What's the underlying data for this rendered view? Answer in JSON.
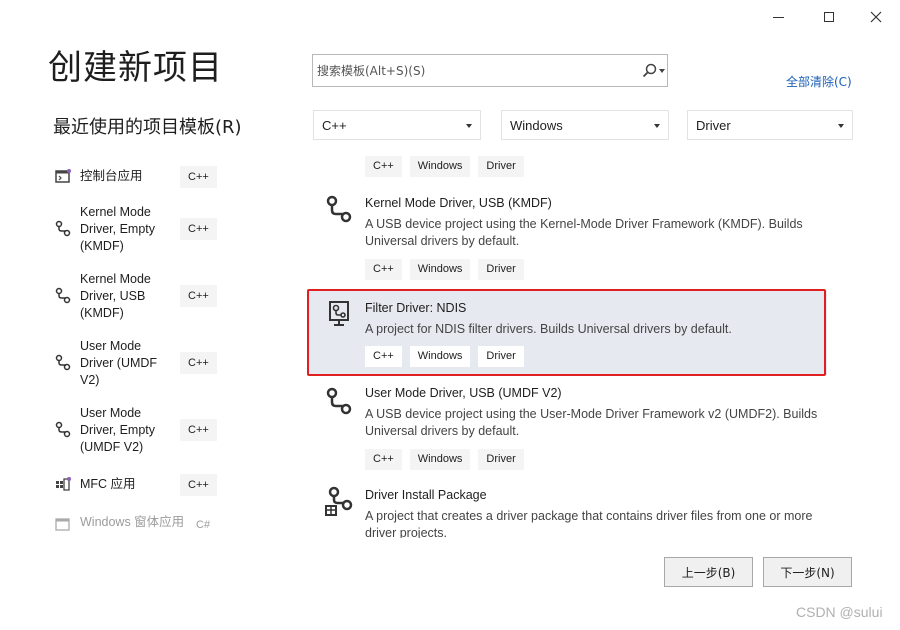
{
  "page_title": "创建新项目",
  "search": {
    "placeholder": "搜索模板(Alt+S)(S)"
  },
  "clear_all": "全部清除(C)",
  "recent_title": "最近使用的项目模板(R)",
  "filters": {
    "language": "C++",
    "platform": "Windows",
    "project_type": "Driver"
  },
  "recent": [
    {
      "name": "控制台应用",
      "tag": "C++",
      "icon": "console-app-icon"
    },
    {
      "name": "Kernel Mode Driver, Empty (KMDF)",
      "tag": "C++",
      "icon": "driver-icon"
    },
    {
      "name": "Kernel Mode Driver, USB (KMDF)",
      "tag": "C++",
      "icon": "driver-icon"
    },
    {
      "name": "User Mode Driver (UMDF V2)",
      "tag": "C++",
      "icon": "driver-icon"
    },
    {
      "name": "User Mode Driver, Empty (UMDF V2)",
      "tag": "C++",
      "icon": "driver-icon"
    },
    {
      "name": "MFC 应用",
      "tag": "C++",
      "icon": "mfc-app-icon"
    },
    {
      "name": "Windows 窗体应用",
      "tag": "C#",
      "icon": "windows-forms-icon"
    }
  ],
  "templates": [
    {
      "title": "",
      "desc": "",
      "tags": [
        "C++",
        "Windows",
        "Driver"
      ]
    },
    {
      "title": "Kernel Mode Driver, USB (KMDF)",
      "desc": "A USB device project using the Kernel-Mode Driver Framework (KMDF). Builds Universal drivers by default.",
      "tags": [
        "C++",
        "Windows",
        "Driver"
      ]
    },
    {
      "title": "Filter Driver: NDIS",
      "desc": "A project for NDIS filter drivers. Builds Universal drivers by default.",
      "tags": [
        "C++",
        "Windows",
        "Driver"
      ]
    },
    {
      "title": "User Mode Driver, USB (UMDF V2)",
      "desc": "A USB device project using the User-Mode Driver Framework v2 (UMDF2). Builds Universal drivers by default.",
      "tags": [
        "C++",
        "Windows",
        "Driver"
      ]
    },
    {
      "title": "Driver Install Package",
      "desc": "A project that creates a driver package that contains driver files from one or more driver projects.",
      "tags": []
    }
  ],
  "buttons": {
    "back": "上一步(B)",
    "next": "下一步(N)"
  },
  "watermark": "CSDN @sului",
  "colors": {
    "accent_link": "#1a5fb4",
    "selection": "#e6e9f0",
    "highlight_border": "#e02020"
  }
}
